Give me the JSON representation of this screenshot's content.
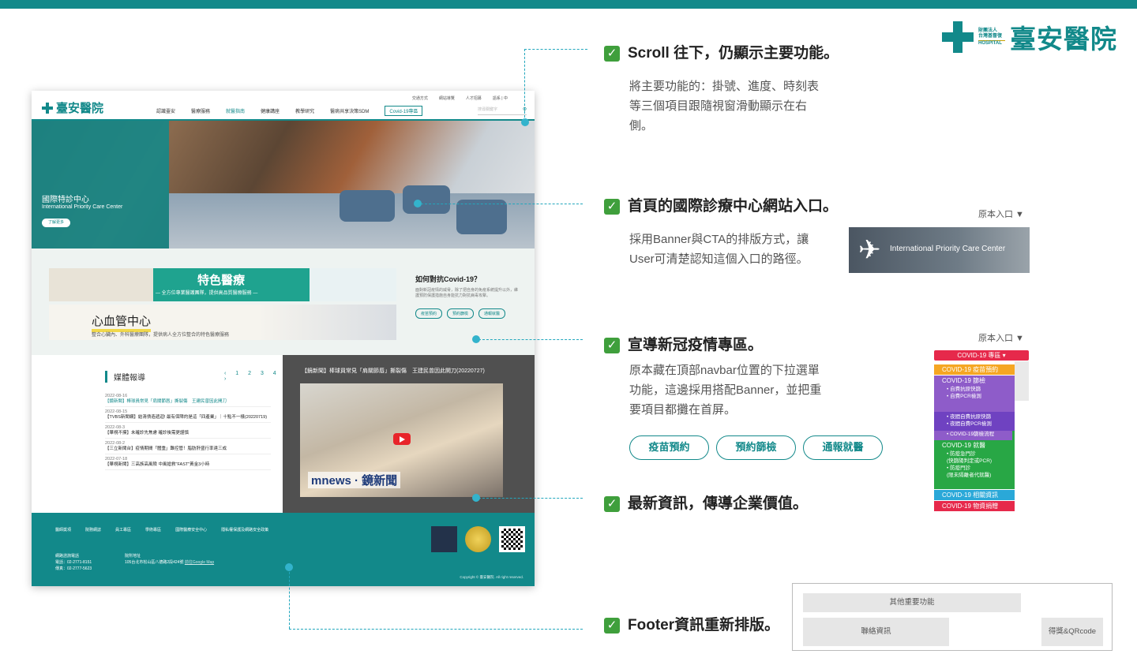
{
  "brand": {
    "name": "臺安醫院",
    "sub_lines": [
      "財團法人",
      "台灣基督復",
      "臨安息日會"
    ],
    "hospital_en": "HOSPITAL",
    "color": "#12898a"
  },
  "mockup": {
    "nav": {
      "logo": "臺安醫院",
      "top_links": [
        "交通方式",
        "網站導覽",
        "人才招募",
        "語系 | 中"
      ],
      "menu": [
        "認識臺安",
        "醫療服務",
        "就醫指南",
        "健康講座",
        "教學研究",
        "醫病共享決策SDM",
        "Covid-19專區"
      ],
      "search_placeholder": "搜尋關鍵字"
    },
    "hero": {
      "title": "國際特診中心",
      "subtitle": "International Priority Care Center",
      "button": "了解更多"
    },
    "special": {
      "title": "特色醫療",
      "subtitle": "— 全方位專業醫護團隊，提供高品質醫療服務 —",
      "heart_title": "心血管中心",
      "heart_sub": "整合心臟內、外科醫療團隊，提供病人全方位整合的特色醫療服務"
    },
    "covid": {
      "title": "如何對抗Covid-19？",
      "desc": "面對新冠疫情的威脅，除了把自身的免疫系統提升以外，維護預防保護措施自身能抗力對抗病毒攻擊。",
      "pills": [
        "疫苗預約",
        "預約篩檢",
        "通報就醫"
      ]
    },
    "news": {
      "heading": "媒體報導",
      "pager": "‹ 1 2 3 4 ›",
      "items": [
        {
          "date": "2022-08-16",
          "title": "【鏡新聞】棒球員常見「肩關節唇」撕裂傷　王建民曾因此開刀",
          "hl": true
        },
        {
          "date": "2022-08-15",
          "title": "【TVBS新聞網】結清債造遞迴! 最有保障的是這「四產業」｜十點不一樣(20220719)",
          "hl": false
        },
        {
          "date": "2022-08-3",
          "title": "【華視不摸】未確診先焦慮 確診後需更謹慎",
          "hl": false
        },
        {
          "date": "2022-08-2",
          "title": "【三立新聞台】疫情期間「體重」難控管！脂肪肝盛行率達三成",
          "hl": false
        },
        {
          "date": "2022-07-18",
          "title": "【華視新聞】三高族高風險 中風搶救\"FAST\"黃金3小時",
          "hl": false
        }
      ]
    },
    "video": {
      "title": "【鏡新聞】棒球員常見「肩關節唇」撕裂傷　王建民曾因此開刀(20220727)",
      "logo": "mnews · 鏡新聞"
    },
    "footer": {
      "links": [
        "醫師獎項",
        "院務網誌",
        "員工專區",
        "學術專區",
        "國際醫療安全中心",
        "隱私權保護及網路安全政策"
      ],
      "contact_title": "網路諮詢電話",
      "phone": "電話：02-2771-8151",
      "fax": "傳真：02-2777-5623",
      "addr_title": "院所地址",
      "addr": "105台北市松山區八德路2段424號",
      "map": "前往Google Map",
      "copyright": "Copyright © 臺安醫院. All right reserved."
    }
  },
  "annotations": [
    {
      "heading": "Scroll 往下，仍顯示主要功能。",
      "body": [
        "將主要功能的：掛號、進度、時刻表",
        "等三個項目跟隨視窗滑動顯示在右",
        "側。"
      ]
    },
    {
      "heading": "首頁的國際診療中心網站入口。",
      "body": [
        "採用Banner與CTA的排版方式，讓",
        "User可清楚認知這個入口的路徑。"
      ],
      "original_label": "原本入口 ▼",
      "banner_text": "International Priority Care Center"
    },
    {
      "heading": "宣導新冠疫情專區。",
      "body": [
        "原本藏在頂部navbar位置的下拉選單",
        "功能，這邊採用搭配Banner，並把重",
        "要項目都攤在首屏。"
      ],
      "original_label": "原本入口 ▼",
      "ctas": [
        "疫苗預約",
        "預約篩檢",
        "通報就醫"
      ]
    },
    {
      "heading": "最新資訊，傳導企業價值。"
    },
    {
      "heading": "Footer資訊重新排版。",
      "footer_blocks": [
        "其他重要功能",
        "聯絡資訊",
        "得獎&QRcode"
      ]
    }
  ],
  "dropdown": {
    "header": "COVID-19 專區",
    "items": [
      {
        "label": "COVID-19 疫苗預約",
        "color": "#f5a623",
        "sub": []
      },
      {
        "label": "COVID-19 篩檢",
        "color": "#8e5cc9",
        "sub": [
          "自費抗原快篩",
          "自費PCR檢測"
        ]
      },
      {
        "label": "",
        "color": "#6f42c1",
        "sub": [
          "夜間自費抗原快篩",
          "夜間自費PCR檢測"
        ]
      },
      {
        "label": "",
        "color": "#8e5cc9",
        "sub": [
          "COVID-19篩檢流程"
        ]
      },
      {
        "label": "COVID-19 就醫",
        "color": "#28a745",
        "sub": [
          "防疫急門診",
          "(快篩陽判定或PCR)",
          "防疫門診",
          "(限未隔離者代就醫)"
        ]
      },
      {
        "label": "COVID-19 相關資訊",
        "color": "#2aa8d8",
        "sub": []
      },
      {
        "label": "COVID-19 物資捐贈",
        "color": "#e6294b",
        "sub": []
      }
    ]
  }
}
